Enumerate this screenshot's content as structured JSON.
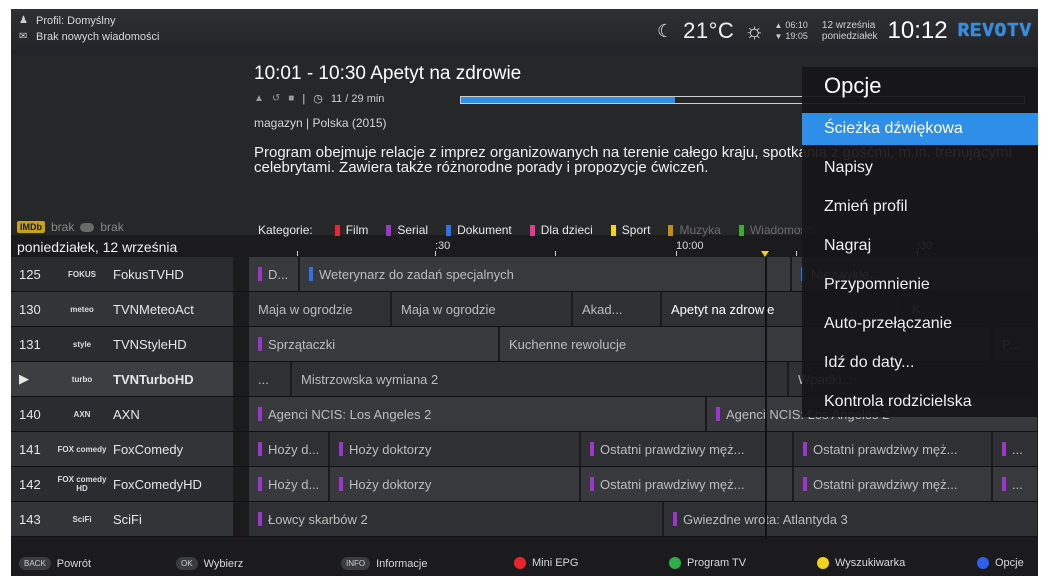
{
  "header": {
    "profile": "Profil: Domyślny",
    "messages": "Brak nowych wiadomości",
    "temperature": "21°C",
    "sunrise": "06:10",
    "sunset": "19:05",
    "date": "12 września",
    "weekday": "poniedziałek",
    "clock": "10:12",
    "brand": "REVOTV"
  },
  "program": {
    "title": "10:01 - 10:30 Apetyt na zdrowie",
    "elapsed": "11 / 29 min",
    "progress_percent": 38,
    "genre": "magazyn | Polska (2015)",
    "description": "Program obejmuje relacje z imprez organizowanych na terenie całego kraju, spotkania z gośćmi, m.in. trenującymi celebrytami. Zawiera także różnorodne porady i propozycje ćwiczeń."
  },
  "ratings": {
    "imdb_badge": "IMDb",
    "imdb_value": "brak",
    "other_value": "brak"
  },
  "guide": {
    "date_label": "poniedziałek, 12 września",
    "categories_label": "Kategorie:",
    "categories": [
      {
        "label": "Film",
        "color": "#e8233a",
        "dim": false
      },
      {
        "label": "Serial",
        "color": "#9b36c8",
        "dim": false
      },
      {
        "label": "Dokument",
        "color": "#2f6fe8",
        "dim": false
      },
      {
        "label": "Dla dzieci",
        "color": "#e83a8c",
        "dim": false
      },
      {
        "label": "Sport",
        "color": "#f2d21a",
        "dim": false
      },
      {
        "label": "Muzyka",
        "color": "#c98a16",
        "dim": true
      },
      {
        "label": "Wiadomości",
        "color": "#3ea83a",
        "dim": true
      }
    ],
    "time_labels": [
      ":30",
      "10:00",
      ":30"
    ],
    "channels": [
      {
        "num": "125",
        "logo": "FOKUS",
        "name": "FokusTVHD",
        "programs": [
          {
            "title": "D...",
            "color": "#9b36c8",
            "active": false
          },
          {
            "title": "Weterynarz do zadań specjalnych",
            "color": "#2f6fe8",
            "active": false
          },
          {
            "title": "Niezwykłe...",
            "color": "#2f6fe8",
            "active": false
          }
        ]
      },
      {
        "num": "130",
        "logo": "meteo",
        "name": "TVNMeteoAct",
        "programs": [
          {
            "title": "Maja w ogrodzie",
            "color": "",
            "active": false
          },
          {
            "title": "Maja w ogrodzie",
            "color": "",
            "active": false
          },
          {
            "title": "Akad...",
            "color": "",
            "active": false
          },
          {
            "title": "Apetyt na zdrowie",
            "color": "",
            "active": true
          },
          {
            "title": "K...",
            "color": "",
            "active": false
          }
        ]
      },
      {
        "num": "131",
        "logo": "style",
        "name": "TVNStyleHD",
        "programs": [
          {
            "title": "Sprzątaczki",
            "color": "#9b36c8",
            "active": false
          },
          {
            "title": "Kuchenne rewolucje",
            "color": "",
            "active": false
          },
          {
            "title": "P...",
            "color": "",
            "active": false
          }
        ]
      },
      {
        "num": "▶",
        "logo": "turbo",
        "name": "TVNTurboHD",
        "programs": [
          {
            "title": "...",
            "color": "",
            "active": false
          },
          {
            "title": "Mistrzowska wymiana 2",
            "color": "",
            "active": false
          },
          {
            "title": "Wpadki...",
            "color": "",
            "active": false
          }
        ]
      },
      {
        "num": "140",
        "logo": "AXN",
        "name": "AXN",
        "programs": [
          {
            "title": "Agenci NCIS: Los Angeles 2",
            "color": "#9b36c8",
            "active": false
          },
          {
            "title": "Agenci NCIS: Los Angeles 2",
            "color": "#9b36c8",
            "active": false
          }
        ]
      },
      {
        "num": "141",
        "logo": "FOX comedy",
        "name": "FoxComedy",
        "programs": [
          {
            "title": "Hoży d...",
            "color": "#9b36c8",
            "active": false
          },
          {
            "title": "Hoży doktorzy",
            "color": "#9b36c8",
            "active": false
          },
          {
            "title": "Ostatni prawdziwy męż...",
            "color": "#9b36c8",
            "active": false
          },
          {
            "title": "Ostatni prawdziwy męż...",
            "color": "#9b36c8",
            "active": false
          },
          {
            "title": "...",
            "color": "#9b36c8",
            "active": false
          }
        ]
      },
      {
        "num": "142",
        "logo": "FOX comedy HD",
        "name": "FoxComedyHD",
        "programs": [
          {
            "title": "Hoży d...",
            "color": "#9b36c8",
            "active": false
          },
          {
            "title": "Hoży doktorzy",
            "color": "#9b36c8",
            "active": false
          },
          {
            "title": "Ostatni prawdziwy męż...",
            "color": "#9b36c8",
            "active": false
          },
          {
            "title": "Ostatni prawdziwy męż...",
            "color": "#9b36c8",
            "active": false
          },
          {
            "title": "...",
            "color": "#9b36c8",
            "active": false
          }
        ]
      },
      {
        "num": "143",
        "logo": "SciFi",
        "name": "SciFi",
        "programs": [
          {
            "title": "Łowcy skarbów 2",
            "color": "#9b36c8",
            "active": false
          },
          {
            "title": "Gwiezdne wrota: Atlantyda 3",
            "color": "#9b36c8",
            "active": false
          }
        ]
      }
    ]
  },
  "menu": {
    "title": "Opcje",
    "items": [
      "Ścieżka dźwiękowa",
      "Napisy",
      "Zmień profil",
      "Nagraj",
      "Przypomnienie",
      "Auto-przełączanie",
      "Idź do daty...",
      "Kontrola rodzicielska"
    ],
    "selected_index": 0
  },
  "footer": {
    "back_key": "BACK",
    "back": "Powrót",
    "ok_key": "OK",
    "ok": "Wybierz",
    "info_key": "INFO",
    "info": "Informacje",
    "red": "Mini EPG",
    "green": "Program TV",
    "yellow": "Wyszukiwarka",
    "blue": "Opcje",
    "colors": {
      "red": "#e8232a",
      "green": "#2fae4a",
      "yellow": "#f2d21a",
      "blue": "#2f5fe8"
    }
  }
}
